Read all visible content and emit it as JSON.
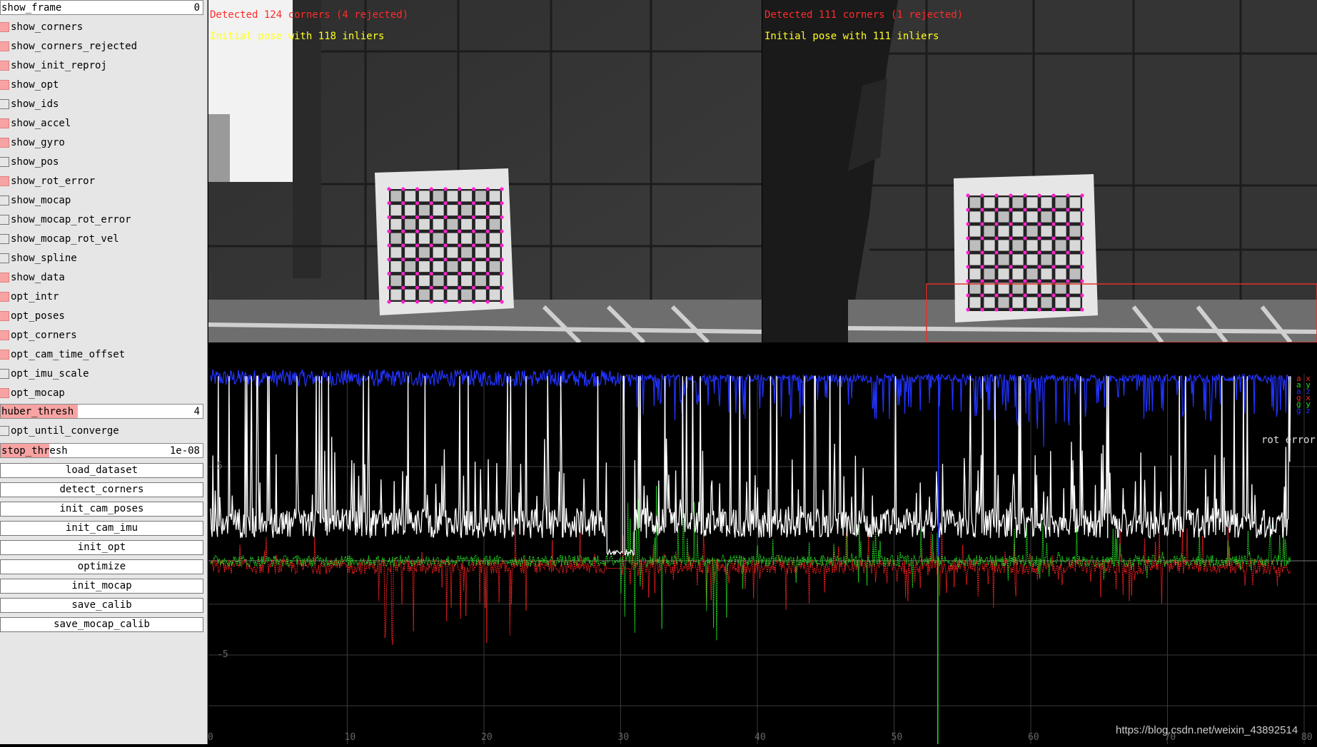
{
  "sidebar": {
    "show_frame": {
      "label": "show_frame",
      "value": "0"
    },
    "checkboxes": [
      {
        "label": "show_corners",
        "checked": true
      },
      {
        "label": "show_corners_rejected",
        "checked": true
      },
      {
        "label": "show_init_reproj",
        "checked": true
      },
      {
        "label": "show_opt",
        "checked": true
      },
      {
        "label": "show_ids",
        "checked": false
      },
      {
        "label": "show_accel",
        "checked": true
      },
      {
        "label": "show_gyro",
        "checked": true
      },
      {
        "label": "show_pos",
        "checked": false
      },
      {
        "label": "show_rot_error",
        "checked": true
      },
      {
        "label": "show_mocap",
        "checked": false
      },
      {
        "label": "show_mocap_rot_error",
        "checked": false
      },
      {
        "label": "show_mocap_rot_vel",
        "checked": false
      },
      {
        "label": "show_spline",
        "checked": false
      },
      {
        "label": "show_data",
        "checked": true
      },
      {
        "label": "opt_intr",
        "checked": true
      },
      {
        "label": "opt_poses",
        "checked": true
      },
      {
        "label": "opt_corners",
        "checked": true
      },
      {
        "label": "opt_cam_time_offset",
        "checked": true
      },
      {
        "label": "opt_imu_scale",
        "checked": false
      },
      {
        "label": "opt_mocap",
        "checked": true
      }
    ],
    "huber_thresh": {
      "label": "huber_thresh",
      "value": "4",
      "fill": 0.38
    },
    "opt_until_converge": {
      "label": "opt_until_converge",
      "checked": false
    },
    "stop_thresh": {
      "label": "stop_thresh",
      "value": "1e-08",
      "fill": 0.24
    },
    "buttons": [
      "load_dataset",
      "detect_corners",
      "init_cam_poses",
      "init_cam_imu",
      "init_opt",
      "optimize",
      "init_mocap",
      "save_calib",
      "save_mocap_calib"
    ]
  },
  "cameras": {
    "left": {
      "detected": "Detected 124 corners (4 rejected)",
      "pose": "Initial pose with 118 inliers"
    },
    "right": {
      "detected": "Detected 111 corners (1 rejected)",
      "pose": "Initial pose with 111 inliers"
    }
  },
  "plot": {
    "x_ticks": [
      "0",
      "10",
      "20",
      "30",
      "40",
      "50",
      "60",
      "70",
      "80"
    ],
    "y_ticks": [
      "5",
      "-5"
    ],
    "legend": [
      {
        "text": "a x",
        "color": "#ff2222"
      },
      {
        "text": "a y",
        "color": "#22dd22"
      },
      {
        "text": "a z",
        "color": "#2233ff"
      },
      {
        "text": "g x",
        "color": "#ff2222"
      },
      {
        "text": "g y",
        "color": "#22dd22"
      },
      {
        "text": "g z",
        "color": "#2233ff"
      }
    ],
    "rot_error_label": "rot error"
  },
  "watermark": "https://blog.csdn.net/weixin_43892514"
}
